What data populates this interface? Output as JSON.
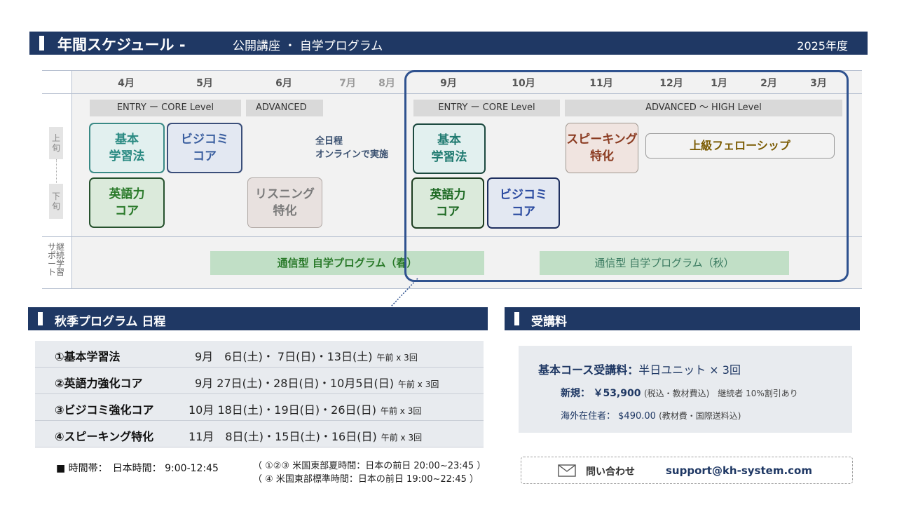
{
  "title_bar": {
    "title": "年間スケジュール",
    "separator": "-",
    "subtitle": "公開講座 ・ 自学プログラム",
    "fiscal_year": "2025年度"
  },
  "schedule": {
    "months": [
      "4月",
      "5月",
      "6月",
      "7月",
      "8月",
      "9月",
      "10月",
      "11月",
      "12月",
      "1月",
      "2月",
      "3月"
    ],
    "row_labels": {
      "upper": "上旬",
      "lower": "下旬",
      "support": "継続学習サポート"
    },
    "level_bands": {
      "spring_entry": "ENTRY ー CORE Level",
      "spring_advanced": "ADVANCED",
      "autumn_entry": "ENTRY ー CORE Level",
      "autumn_advanced": "ADVANCED ～ HIGH Level"
    },
    "courses": {
      "spring_basic": "基本\n学習法",
      "spring_bizcomm": "ビジコミ\nコア",
      "spring_english": "英語力\nコア",
      "spring_listening": "リスニング\n特化",
      "autumn_basic": "基本\n学習法",
      "autumn_english": "英語力\nコア",
      "autumn_bizcomm": "ビジコミ\nコア",
      "autumn_speaking": "スピーキング\n特化",
      "fellowship": "上級フェローシップ"
    },
    "online_note": "全日程\nオンラインで実施",
    "correspondence": {
      "spring": "通信型 自学プログラム（春）",
      "autumn": "通信型 自学プログラム（秋）"
    }
  },
  "autumn_section": {
    "heading": "秋季プログラム 日程",
    "rows": [
      {
        "name": "①基本学習法",
        "dates": "9月　6日(土)・ 7日(日)・13日(土)",
        "unit": "午前 x 3回"
      },
      {
        "name": "②英語力強化コア",
        "dates": "9月 27日(土)・28日(日)・10月5日(日)",
        "unit": "午前 x 3回"
      },
      {
        "name": "③ビジコミ強化コア",
        "dates": "10月 18日(土)・19日(日)・26日(日)",
        "unit": "午前 x 3回"
      },
      {
        "name": "④スピーキング特化",
        "dates": "11月　8日(土)・15日(土)・16日(日)",
        "unit": "午前 x 3回"
      }
    ],
    "time_label": "■ 時間帯：　日本時間： 9:00-12:45",
    "time_note_1": "（ ①②③ 米国東部夏時間：日本の前日 20:00~23:45 ）",
    "time_note_2": "（ ④ 米国東部標準時間：日本の前日 19:00~22:45 ）"
  },
  "fee_section": {
    "heading": "受講料",
    "title_bold": "基本コース受講料：",
    "title_rest": "半日ユニット × 3回",
    "new_label": "新規：",
    "new_price": "￥53,900",
    "new_note": "(税込・教材費込)　継続者 10%割引あり",
    "overseas_label": "海外在住者：",
    "overseas_price": "$490.00",
    "overseas_note": "(教材費・国際送料込)"
  },
  "contact": {
    "icon": "mail-icon",
    "label": "問い合わせ",
    "email": "support@kh-system.com"
  },
  "colors": {
    "navy": "#1f3864",
    "highlight_border": "#2f528f",
    "correspondence_green": "#c1dfc6",
    "level_band_gray": "#d9d9d9"
  }
}
